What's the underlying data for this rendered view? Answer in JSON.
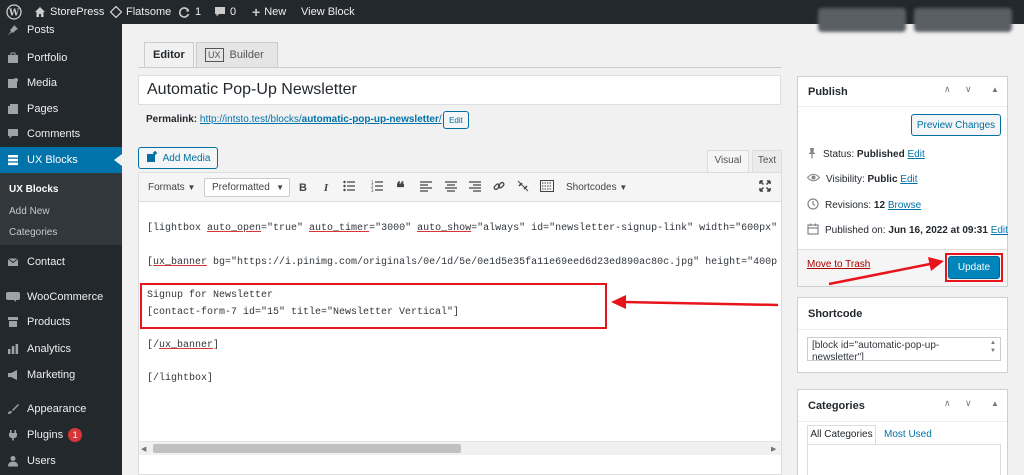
{
  "adminbar": {
    "site": "StorePress",
    "theme": "Flatsome",
    "updates": "1",
    "comments": "0",
    "new": "New",
    "view": "View Block"
  },
  "menu": {
    "posts": "Posts",
    "portfolio": "Portfolio",
    "media": "Media",
    "pages": "Pages",
    "comments": "Comments",
    "ux_blocks": "UX Blocks",
    "sub": {
      "ux_blocks": "UX Blocks",
      "add_new": "Add New",
      "categories": "Categories"
    },
    "contact": "Contact",
    "woocommerce": "WooCommerce",
    "products": "Products",
    "analytics": "Analytics",
    "marketing": "Marketing",
    "appearance": "Appearance",
    "plugins": "Plugins",
    "plugins_count": "1",
    "users": "Users"
  },
  "tabs": {
    "editor": "Editor",
    "ux_badge": "UX",
    "builder": "Builder"
  },
  "title": "Automatic Pop-Up Newsletter",
  "permalink": {
    "label": "Permalink:",
    "url_base": "http://intsto.test/blocks/",
    "url_slug": "automatic-pop-up-newsletter",
    "url_end": "/",
    "edit": "Edit"
  },
  "editor": {
    "add_media": "Add Media",
    "visual_tab": "Visual",
    "text_tab": "Text",
    "formats": "Formats",
    "preformatted": "Preformatted",
    "shortcodes": "Shortcodes",
    "lines": {
      "l1a": "[lightbox ",
      "l1b": "auto_open",
      "l1c": "=\"true\" ",
      "l1d": "auto_timer",
      "l1e": "=\"3000\" ",
      "l1f": "auto_show",
      "l1g": "=\"always\" id=\"newsletter-signup-link\" width=\"600px\"",
      "l2a": "[",
      "l2b": "ux_banner",
      "l2c": "  bg=\"https://i.pinimg.com/originals/0e/1d/5e/0e1d5e35fa11e69eed6d23ed890ac80c.jpg\" height=\"400p",
      "l3": "Signup for Newsletter",
      "l4": "[contact-form-7 id=\"15\" title=\"Newsletter Vertical\"]",
      "l5a": "[/",
      "l5b": "ux_banner",
      "l5c": "]",
      "l6": "[/lightbox]"
    }
  },
  "publish": {
    "title": "Publish",
    "preview": "Preview Changes",
    "status_label": "Status:",
    "status_value": "Published",
    "visibility_label": "Visibility:",
    "visibility_value": "Public",
    "revisions_label": "Revisions:",
    "revisions_value": "12",
    "browse": "Browse",
    "published_label": "Published on:",
    "published_value": "Jun 16, 2022 at 09:31",
    "edit": "Edit",
    "trash": "Move to Trash",
    "update": "Update"
  },
  "shortcode": {
    "title": "Shortcode",
    "value": "[block id=\"automatic-pop-up-\nnewsletter\"]"
  },
  "categories": {
    "title": "Categories",
    "all": "All Categories",
    "most_used": "Most Used"
  },
  "colors": {
    "annotation": "#e8141c",
    "accent": "#0073aa",
    "update": "#0085ba"
  }
}
